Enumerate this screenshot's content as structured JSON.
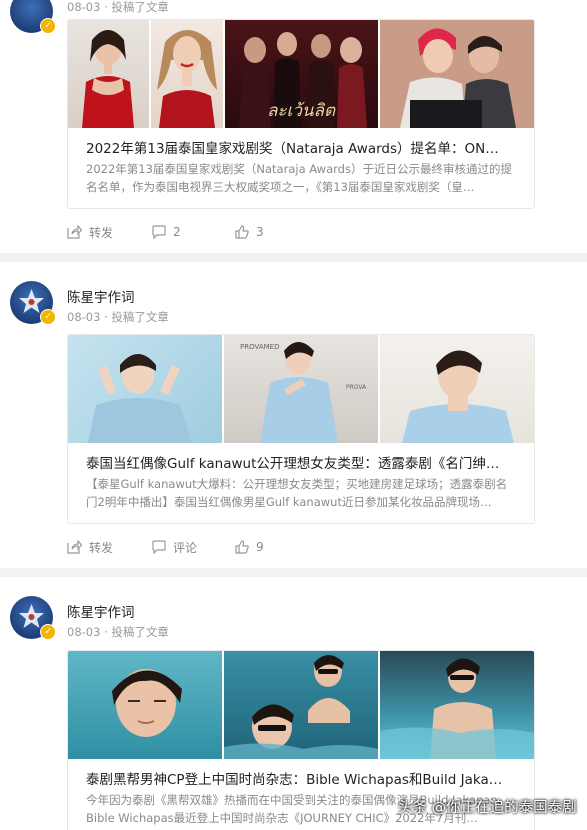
{
  "posts": [
    {
      "author": "",
      "date": "08-03",
      "action": "投稿了文章",
      "title": "2022年第13届泰国皇家戏剧奖（Nataraja Awards）提名单：ON…",
      "desc": "2022年第13届泰国皇家戏剧奖（Nataraja Awards）于近日公示最终审核通过的提名名单，作为泰国电视界三大权威奖项之一，《第13届泰国皇家戏剧奖（皇…",
      "share_label": "转发",
      "comment_label": "2",
      "like_label": "3",
      "poster_text": "ละเว้นลิต"
    },
    {
      "author": "陈星宇作词",
      "date": "08-03",
      "action": "投稿了文章",
      "title": "泰国当红偶像Gulf kanawut公开理想女友类型：透露泰剧《名门绅…",
      "desc": "【泰星Gulf kanawut大爆料：公开理想女友类型；买地建房建足球场；透露泰剧名门2明年中播出】泰国当红偶像男星Gulf kanawut近日参加某化妆品品牌现场…",
      "share_label": "转发",
      "comment_label": "评论",
      "like_label": "9"
    },
    {
      "author": "陈星宇作词",
      "date": "08-03",
      "action": "投稿了文章",
      "title": "泰剧黑帮男神CP登上中国时尚杂志：Bible Wichapas和Build Jaka…",
      "desc": "今年因为泰剧《黑帮双雄》热播而在中国受到关注的泰国偶像演员Build Jakapan、Bible Wichapas最近登上中国时尚杂志《JOURNEY CHIC》2022年7月刊…"
    }
  ],
  "watermark": "头条 @你正在追的泰国泰剧",
  "icons": {
    "share": "share-icon",
    "comment": "comment-icon",
    "like": "like-icon",
    "verified": "verified-badge-icon"
  },
  "colors": {
    "separator": "#f2f2f2",
    "meta": "#999999",
    "badge": "#f5b400"
  }
}
